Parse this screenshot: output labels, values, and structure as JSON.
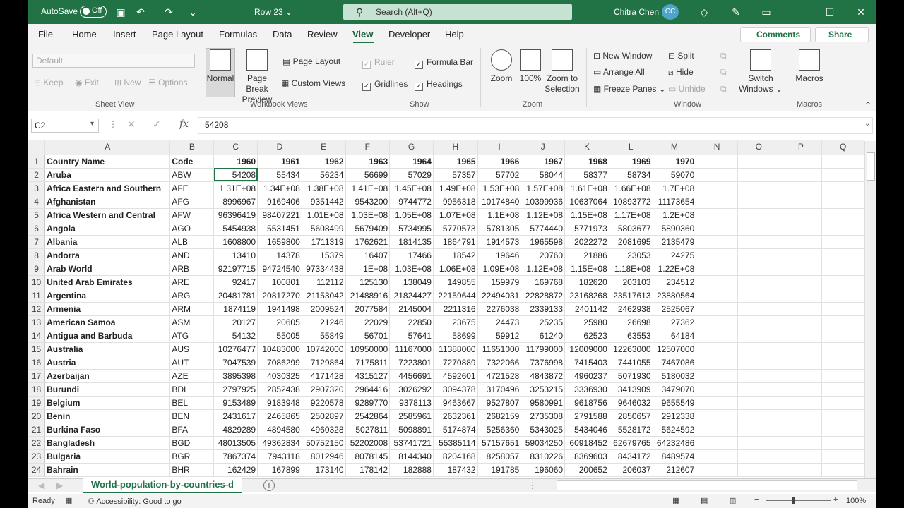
{
  "titlebar": {
    "autosave_label": "AutoSave",
    "autosave_state": "Off",
    "doc_title": "Row 23 ⌄",
    "search_placeholder": "Search (Alt+Q)",
    "user_name": "Chitra Chen",
    "user_initials": "CC"
  },
  "menu": [
    "File",
    "Home",
    "Insert",
    "Page Layout",
    "Formulas",
    "Data",
    "Review",
    "View",
    "Developer",
    "Help"
  ],
  "menu_active": "View",
  "comments_label": "Comments",
  "share_label": "Share",
  "ribbon": {
    "sheet_view": {
      "dropdown": "Default",
      "keep": "Keep",
      "exit": "Exit",
      "new": "New",
      "options": "Options",
      "label": "Sheet View"
    },
    "workbook_views": {
      "normal": "Normal",
      "page_break": "Page Break Preview",
      "page_layout": "Page Layout",
      "custom_views": "Custom Views",
      "label": "Workbook Views"
    },
    "show": {
      "ruler": "Ruler",
      "formula_bar": "Formula Bar",
      "gridlines": "Gridlines",
      "headings": "Headings",
      "label": "Show"
    },
    "zoom": {
      "zoom": "Zoom",
      "hundred": "100%",
      "zoom_sel": "Zoom to Selection",
      "label": "Zoom"
    },
    "window": {
      "new_window": "New Window",
      "arrange_all": "Arrange All",
      "freeze_panes": "Freeze Panes",
      "split": "Split",
      "hide": "Hide",
      "unhide": "Unhide",
      "switch": "Switch Windows",
      "label": "Window"
    },
    "macros": {
      "macros": "Macros",
      "label": "Macros"
    }
  },
  "formula_bar": {
    "name_box": "C2",
    "value": "54208"
  },
  "columns": [
    "A",
    "B",
    "C",
    "D",
    "E",
    "F",
    "G",
    "H",
    "I",
    "J",
    "K",
    "L",
    "M",
    "N",
    "O",
    "P",
    "Q"
  ],
  "header_row": [
    "Country Name",
    "Code",
    "1960",
    "1961",
    "1962",
    "1963",
    "1964",
    "1965",
    "1966",
    "1967",
    "1968",
    "1969",
    "1970"
  ],
  "rows": [
    [
      "Aruba",
      "ABW",
      "54208",
      "55434",
      "56234",
      "56699",
      "57029",
      "57357",
      "57702",
      "58044",
      "58377",
      "58734",
      "59070"
    ],
    [
      "Africa Eastern and Southern",
      "AFE",
      "1.31E+08",
      "1.34E+08",
      "1.38E+08",
      "1.41E+08",
      "1.45E+08",
      "1.49E+08",
      "1.53E+08",
      "1.57E+08",
      "1.61E+08",
      "1.66E+08",
      "1.7E+08"
    ],
    [
      "Afghanistan",
      "AFG",
      "8996967",
      "9169406",
      "9351442",
      "9543200",
      "9744772",
      "9956318",
      "10174840",
      "10399936",
      "10637064",
      "10893772",
      "11173654"
    ],
    [
      "Africa Western and Central",
      "AFW",
      "96396419",
      "98407221",
      "1.01E+08",
      "1.03E+08",
      "1.05E+08",
      "1.07E+08",
      "1.1E+08",
      "1.12E+08",
      "1.15E+08",
      "1.17E+08",
      "1.2E+08"
    ],
    [
      "Angola",
      "AGO",
      "5454938",
      "5531451",
      "5608499",
      "5679409",
      "5734995",
      "5770573",
      "5781305",
      "5774440",
      "5771973",
      "5803677",
      "5890360"
    ],
    [
      "Albania",
      "ALB",
      "1608800",
      "1659800",
      "1711319",
      "1762621",
      "1814135",
      "1864791",
      "1914573",
      "1965598",
      "2022272",
      "2081695",
      "2135479"
    ],
    [
      "Andorra",
      "AND",
      "13410",
      "14378",
      "15379",
      "16407",
      "17466",
      "18542",
      "19646",
      "20760",
      "21886",
      "23053",
      "24275"
    ],
    [
      "Arab World",
      "ARB",
      "92197715",
      "94724540",
      "97334438",
      "1E+08",
      "1.03E+08",
      "1.06E+08",
      "1.09E+08",
      "1.12E+08",
      "1.15E+08",
      "1.18E+08",
      "1.22E+08"
    ],
    [
      "United Arab Emirates",
      "ARE",
      "92417",
      "100801",
      "112112",
      "125130",
      "138049",
      "149855",
      "159979",
      "169768",
      "182620",
      "203103",
      "234512"
    ],
    [
      "Argentina",
      "ARG",
      "20481781",
      "20817270",
      "21153042",
      "21488916",
      "21824427",
      "22159644",
      "22494031",
      "22828872",
      "23168268",
      "23517613",
      "23880564"
    ],
    [
      "Armenia",
      "ARM",
      "1874119",
      "1941498",
      "2009524",
      "2077584",
      "2145004",
      "2211316",
      "2276038",
      "2339133",
      "2401142",
      "2462938",
      "2525067"
    ],
    [
      "American Samoa",
      "ASM",
      "20127",
      "20605",
      "21246",
      "22029",
      "22850",
      "23675",
      "24473",
      "25235",
      "25980",
      "26698",
      "27362"
    ],
    [
      "Antigua and Barbuda",
      "ATG",
      "54132",
      "55005",
      "55849",
      "56701",
      "57641",
      "58699",
      "59912",
      "61240",
      "62523",
      "63553",
      "64184"
    ],
    [
      "Australia",
      "AUS",
      "10276477",
      "10483000",
      "10742000",
      "10950000",
      "11167000",
      "11388000",
      "11651000",
      "11799000",
      "12009000",
      "12263000",
      "12507000"
    ],
    [
      "Austria",
      "AUT",
      "7047539",
      "7086299",
      "7129864",
      "7175811",
      "7223801",
      "7270889",
      "7322066",
      "7376998",
      "7415403",
      "7441055",
      "7467086"
    ],
    [
      "Azerbaijan",
      "AZE",
      "3895398",
      "4030325",
      "4171428",
      "4315127",
      "4456691",
      "4592601",
      "4721528",
      "4843872",
      "4960237",
      "5071930",
      "5180032"
    ],
    [
      "Burundi",
      "BDI",
      "2797925",
      "2852438",
      "2907320",
      "2964416",
      "3026292",
      "3094378",
      "3170496",
      "3253215",
      "3336930",
      "3413909",
      "3479070"
    ],
    [
      "Belgium",
      "BEL",
      "9153489",
      "9183948",
      "9220578",
      "9289770",
      "9378113",
      "9463667",
      "9527807",
      "9580991",
      "9618756",
      "9646032",
      "9655549"
    ],
    [
      "Benin",
      "BEN",
      "2431617",
      "2465865",
      "2502897",
      "2542864",
      "2585961",
      "2632361",
      "2682159",
      "2735308",
      "2791588",
      "2850657",
      "2912338"
    ],
    [
      "Burkina Faso",
      "BFA",
      "4829289",
      "4894580",
      "4960328",
      "5027811",
      "5098891",
      "5174874",
      "5256360",
      "5343025",
      "5434046",
      "5528172",
      "5624592"
    ],
    [
      "Bangladesh",
      "BGD",
      "48013505",
      "49362834",
      "50752150",
      "52202008",
      "53741721",
      "55385114",
      "57157651",
      "59034250",
      "60918452",
      "62679765",
      "64232486"
    ],
    [
      "Bulgaria",
      "BGR",
      "7867374",
      "7943118",
      "8012946",
      "8078145",
      "8144340",
      "8204168",
      "8258057",
      "8310226",
      "8369603",
      "8434172",
      "8489574"
    ],
    [
      "Bahrain",
      "BHR",
      "162429",
      "167899",
      "173140",
      "178142",
      "182888",
      "187432",
      "191785",
      "196060",
      "200652",
      "206037",
      "212607"
    ]
  ],
  "sheet_tab": "World-population-by-countries-d",
  "status": {
    "ready": "Ready",
    "accessibility": "Accessibility: Good to go",
    "zoom": "100%"
  }
}
